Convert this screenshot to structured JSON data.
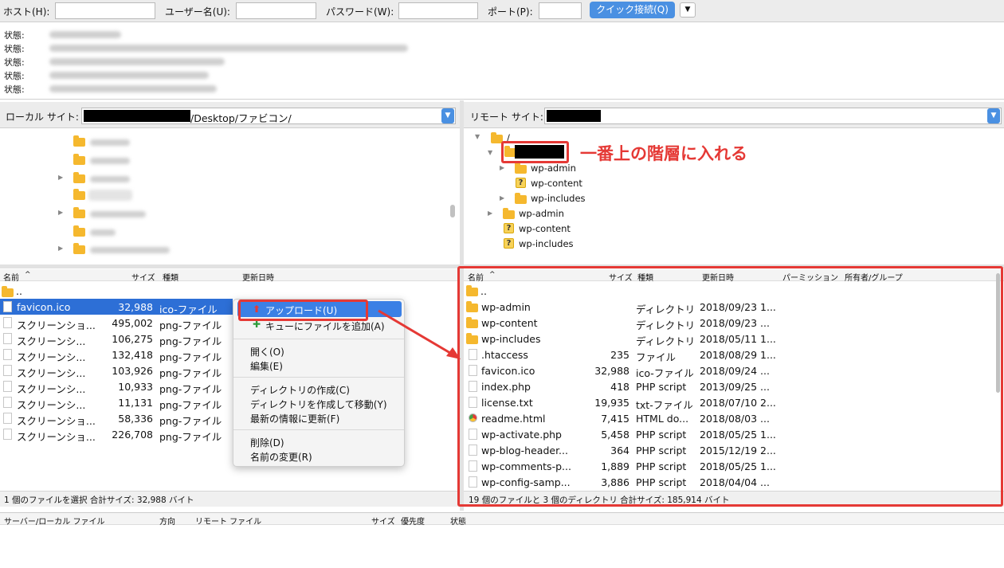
{
  "quickconnect": {
    "host_label": "ホスト(H):",
    "user_label": "ユーザー名(U):",
    "pass_label": "パスワード(W):",
    "port_label": "ポート(P):",
    "button": "クイック接続(Q)"
  },
  "log": {
    "label": "状態:",
    "count": 5
  },
  "local": {
    "site_label": "ローカル サイト:",
    "path": "/Desktop/ファビコン/",
    "columns": [
      "名前",
      "サイズ",
      "種類",
      "更新日時"
    ],
    "files": [
      {
        "name": "..",
        "size": "",
        "type": ""
      },
      {
        "name": "favicon.ico",
        "size": "32,988",
        "type": "ico-ファイル"
      },
      {
        "name": "スクリーンショ...",
        "size": "495,002",
        "type": "png-ファイル"
      },
      {
        "name": "スクリーンシ...",
        "size": "106,275",
        "type": "png-ファイル"
      },
      {
        "name": "スクリーンシ...",
        "size": "132,418",
        "type": "png-ファイル"
      },
      {
        "name": "スクリーンシ...",
        "size": "103,926",
        "type": "png-ファイル"
      },
      {
        "name": "スクリーンシ...",
        "size": "10,933",
        "type": "png-ファイル"
      },
      {
        "name": "スクリーンシ...",
        "size": "11,131",
        "type": "png-ファイル"
      },
      {
        "name": "スクリーンショ...",
        "size": "58,336",
        "type": "png-ファイル"
      },
      {
        "name": "スクリーンショ...",
        "size": "226,708",
        "type": "png-ファイル"
      }
    ],
    "status": "1 個のファイルを選択 合計サイズ: 32,988 バイト"
  },
  "context_menu": {
    "upload": "アップロード(U)",
    "queue": "キューにファイルを追加(A)",
    "open": "開く(O)",
    "edit": "編集(E)",
    "mkdir": "ディレクトリの作成(C)",
    "mkdir_move": "ディレクトリを作成して移動(Y)",
    "refresh": "最新の情報に更新(F)",
    "delete": "削除(D)",
    "rename": "名前の変更(R)"
  },
  "remote": {
    "site_label": "リモート サイト:",
    "tree": {
      "root": "/",
      "inner": [
        "wp-admin",
        "wp-content",
        "wp-includes"
      ],
      "outer": [
        "wp-admin",
        "wp-content",
        "wp-includes"
      ]
    },
    "annotation": "一番上の階層に入れる",
    "columns": [
      "名前",
      "サイズ",
      "種類",
      "更新日時",
      "パーミッション",
      "所有者/グループ"
    ],
    "files": [
      {
        "name": "..",
        "size": "",
        "type": "",
        "date": ""
      },
      {
        "name": "wp-admin",
        "size": "",
        "type": "ディレクトリ",
        "date": "2018/09/23 1..."
      },
      {
        "name": "wp-content",
        "size": "",
        "type": "ディレクトリ",
        "date": "2018/09/23 ..."
      },
      {
        "name": "wp-includes",
        "size": "",
        "type": "ディレクトリ",
        "date": "2018/05/11 1..."
      },
      {
        "name": ".htaccess",
        "size": "235",
        "type": "ファイル",
        "date": "2018/08/29 1..."
      },
      {
        "name": "favicon.ico",
        "size": "32,988",
        "type": "ico-ファイル",
        "date": "2018/09/24 ..."
      },
      {
        "name": "index.php",
        "size": "418",
        "type": "PHP script",
        "date": "2013/09/25 ..."
      },
      {
        "name": "license.txt",
        "size": "19,935",
        "type": "txt-ファイル",
        "date": "2018/07/10 2..."
      },
      {
        "name": "readme.html",
        "size": "7,415",
        "type": "HTML do...",
        "date": "2018/08/03 ..."
      },
      {
        "name": "wp-activate.php",
        "size": "5,458",
        "type": "PHP script",
        "date": "2018/05/25 1..."
      },
      {
        "name": "wp-blog-header...",
        "size": "364",
        "type": "PHP script",
        "date": "2015/12/19 2..."
      },
      {
        "name": "wp-comments-p...",
        "size": "1,889",
        "type": "PHP script",
        "date": "2018/05/25 1..."
      },
      {
        "name": "wp-config-samp...",
        "size": "3,886",
        "type": "PHP script",
        "date": "2018/04/04 ..."
      }
    ],
    "status": "19 個のファイルと 3 個のディレクトリ 合計サイズ: 185,914 バイト"
  },
  "queue": {
    "columns": [
      "サーバー/ローカル ファイル",
      "方向",
      "リモート ファイル",
      "サイズ",
      "優先度",
      "状態"
    ]
  },
  "colors": {
    "accent": "#4a90e2",
    "selection": "#2d6fd6",
    "annotation_red": "#e53935",
    "folder": "#f5b82e"
  }
}
